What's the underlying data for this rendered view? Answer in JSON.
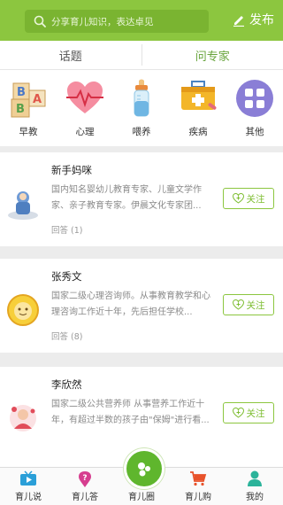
{
  "header": {
    "search_placeholder": "分享育儿知识，表达卓见",
    "publish_label": "发布"
  },
  "tabs": [
    {
      "label": "话题",
      "active": false
    },
    {
      "label": "问专家",
      "active": true
    }
  ],
  "categories": [
    {
      "label": "早教",
      "icon": "alphabet-blocks-icon"
    },
    {
      "label": "心理",
      "icon": "heart-pulse-icon"
    },
    {
      "label": "喂养",
      "icon": "baby-bottle-icon"
    },
    {
      "label": "疾病",
      "icon": "medical-kit-icon"
    },
    {
      "label": "其他",
      "icon": "grid-icon"
    }
  ],
  "experts": [
    {
      "name": "新手妈咪",
      "description": "国内知名婴幼儿教育专家、儿童文学作家、亲子教育专家。伊晨文化专家团...",
      "answers": "回答 (1)",
      "follow_label": "关注"
    },
    {
      "name": "张秀文",
      "description": "国家二级心理咨询师。从事教育教学和心理咨询工作近十年，先后担任学校...",
      "answers": "回答 (8)",
      "follow_label": "关注"
    },
    {
      "name": "李欣然",
      "description": "国家二级公共营养师 从事营养工作近十年，有超过半数的孩子由\"保姆\"进行看...",
      "answers": "",
      "follow_label": "关注"
    }
  ],
  "bottom_nav": [
    {
      "label": "育儿说",
      "icon": "tv-icon"
    },
    {
      "label": "育儿答",
      "icon": "question-pin-icon"
    },
    {
      "label": "育儿圈",
      "icon": "circle-drops-icon"
    },
    {
      "label": "育儿购",
      "icon": "cart-icon"
    },
    {
      "label": "我的",
      "icon": "person-icon"
    }
  ],
  "colors": {
    "brand": "#8cc63f",
    "active_tab": "#66a33a",
    "center_button": "#5fb62d"
  }
}
